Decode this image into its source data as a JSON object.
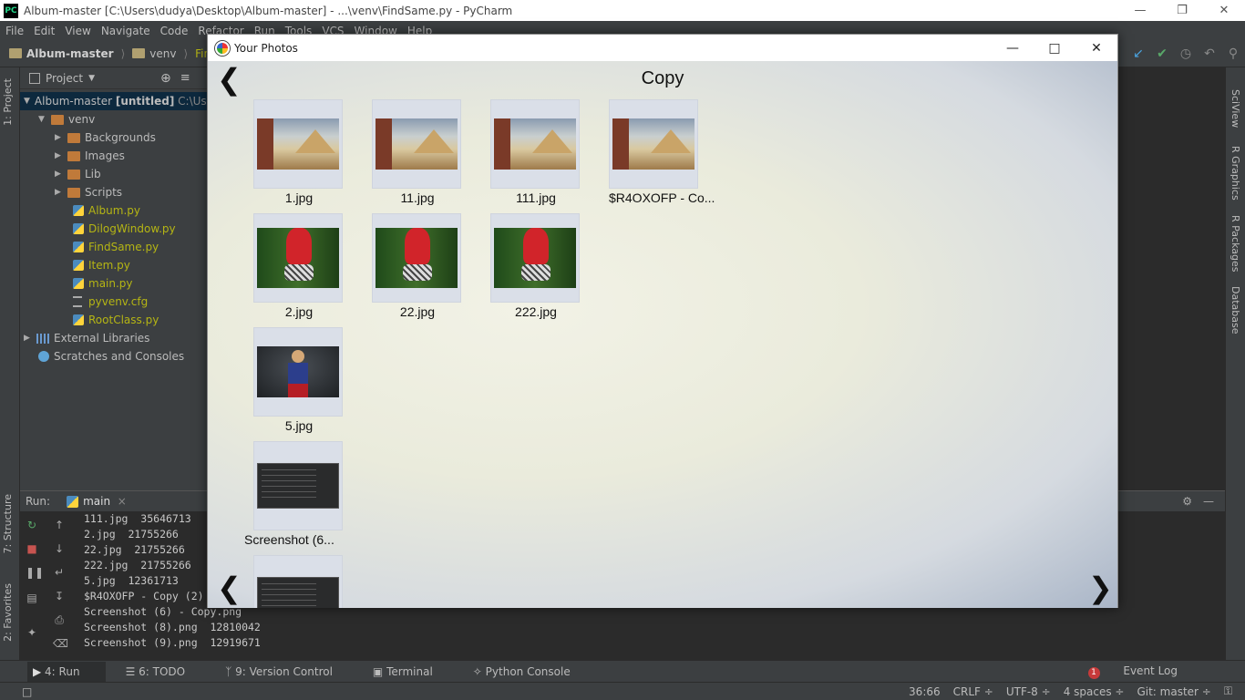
{
  "window": {
    "title": "Album-master [C:\\Users\\dudya\\Desktop\\Album-master] - ...\\venv\\FindSame.py - PyCharm",
    "icon_label": "PC"
  },
  "menu": [
    "File",
    "Edit",
    "View",
    "Navigate",
    "Code",
    "Refactor",
    "Run",
    "Tools",
    "VCS",
    "Window",
    "Help"
  ],
  "breadcrumb": [
    "Album-master",
    "venv",
    "FindS"
  ],
  "left_tabs": [
    "1: Project",
    "7: Structure",
    "2: Favorites"
  ],
  "right_tabs": [
    "SciView",
    "R Graphics",
    "R Packages",
    "Database"
  ],
  "project": {
    "header": "Project",
    "root": "Album-master",
    "root_tag": "[untitled]",
    "root_path": "C:\\Users",
    "items": [
      {
        "label": "venv",
        "kind": "folder"
      },
      {
        "label": "Backgrounds",
        "kind": "folder"
      },
      {
        "label": "Images",
        "kind": "folder"
      },
      {
        "label": "Lib",
        "kind": "folder"
      },
      {
        "label": "Scripts",
        "kind": "folder"
      },
      {
        "label": "Album.py",
        "kind": "py"
      },
      {
        "label": "DilogWindow.py",
        "kind": "py"
      },
      {
        "label": "FindSame.py",
        "kind": "py"
      },
      {
        "label": "Item.py",
        "kind": "py"
      },
      {
        "label": "main.py",
        "kind": "py"
      },
      {
        "label": "pyvenv.cfg",
        "kind": "cfg"
      },
      {
        "label": "RootClass.py",
        "kind": "py"
      },
      {
        "label": "External Libraries",
        "kind": "lib"
      },
      {
        "label": "Scratches and Consoles",
        "kind": "scratch"
      }
    ]
  },
  "run": {
    "label": "Run:",
    "tab": "main",
    "console": [
      "111.jpg  35646713",
      "2.jpg  21755266",
      "22.jpg  21755266",
      "222.jpg  21755266",
      "5.jpg  12361713",
      "$R4OXOFP - Copy (2)",
      "Screenshot (6) - Copy.png",
      "Screenshot (8).png  12810042",
      "Screenshot (9).png  12919671"
    ]
  },
  "bottom_tabs": [
    "4: Run",
    "6: TODO",
    "9: Version Control",
    "Terminal",
    "Python Console"
  ],
  "event_log": {
    "count": "1",
    "label": "Event Log"
  },
  "status_bar": [
    "36:66",
    "CRLF ÷",
    "UTF-8 ÷",
    "4 spaces ÷",
    "Git: master ÷"
  ],
  "dialog": {
    "title": "Your Photos",
    "heading": "Copy",
    "photos": [
      {
        "caption": "1.jpg",
        "image": "egypt"
      },
      {
        "caption": "11.jpg",
        "image": "egypt"
      },
      {
        "caption": "111.jpg",
        "image": "egypt"
      },
      {
        "caption": "$R4OXOFP - Co...",
        "image": "egypt"
      },
      {
        "caption": "2.jpg",
        "image": "redhair"
      },
      {
        "caption": "22.jpg",
        "image": "redhair"
      },
      {
        "caption": "222.jpg",
        "image": "redhair"
      },
      {
        "caption": "5.jpg",
        "image": "supergirl"
      },
      {
        "caption": "Screenshot (6...",
        "image": "screenshot"
      },
      {
        "caption": "",
        "image": "screenshot"
      }
    ]
  }
}
